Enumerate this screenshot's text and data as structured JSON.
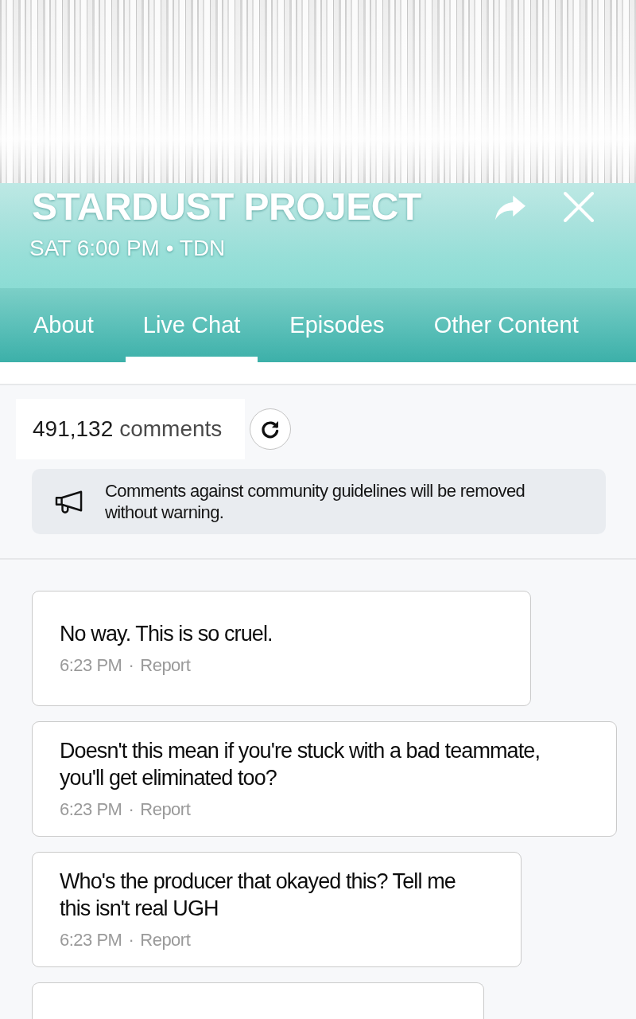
{
  "header": {
    "title": "STARDUST PROJECT",
    "subtitle": "SAT 6:00 PM • TDN"
  },
  "tabs": [
    {
      "label": "About",
      "selected": false
    },
    {
      "label": "Live Chat",
      "selected": true
    },
    {
      "label": "Episodes",
      "selected": false
    },
    {
      "label": "Other Content",
      "selected": false
    }
  ],
  "comment_count": {
    "number": "491,132",
    "label": "comments"
  },
  "notice": {
    "text": "Comments against community guidelines will be removed without warning."
  },
  "comments": [
    {
      "kind": "message",
      "text": "No way. This is so cruel.",
      "time": "6:23 PM",
      "separator": "·",
      "action": "Report"
    },
    {
      "kind": "message",
      "text": "Doesn't this mean if you're stuck with a bad teammate, you'll get eliminated too?",
      "time": "6:23 PM",
      "separator": "·",
      "action": "Report"
    },
    {
      "kind": "message",
      "text": "Who's the producer that okayed this? Tell me this isn't real UGH",
      "time": "6:23 PM",
      "separator": "·",
      "action": "Report"
    },
    {
      "kind": "cut_off"
    }
  ]
}
